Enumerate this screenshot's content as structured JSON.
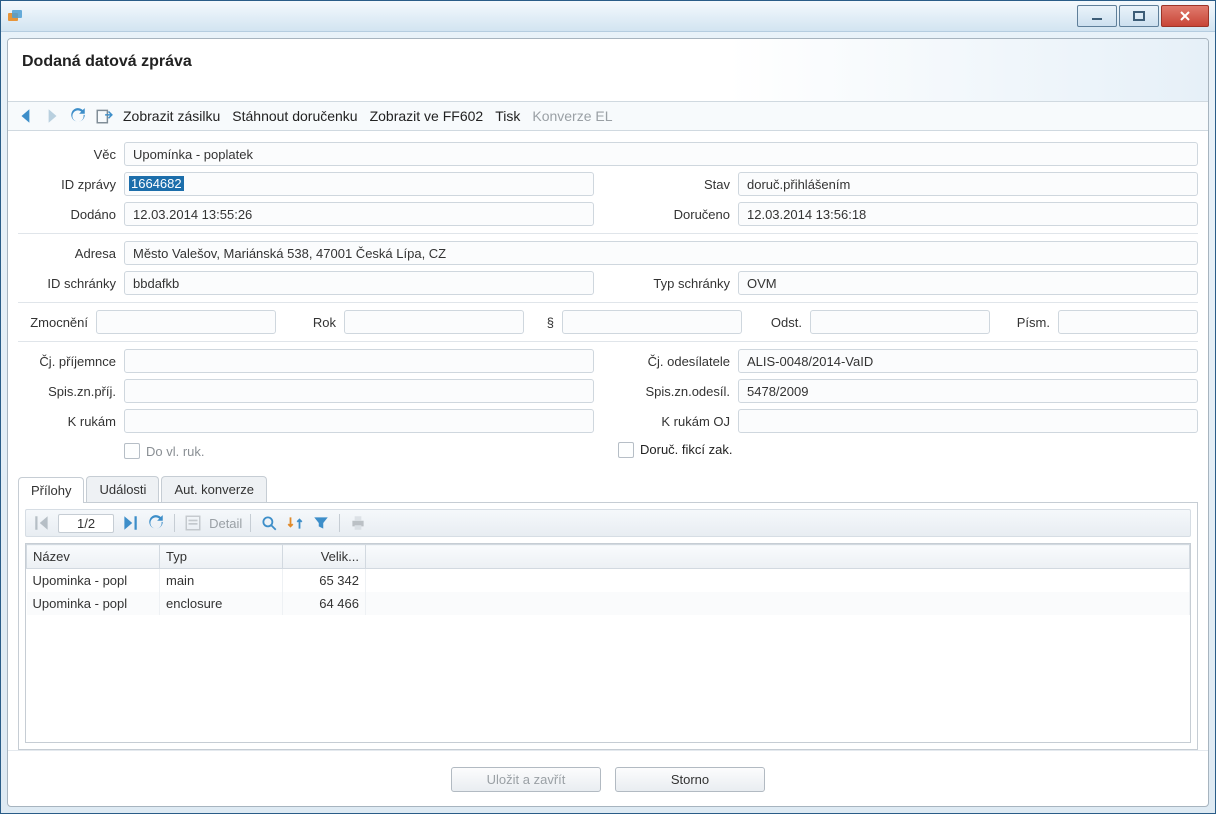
{
  "window": {
    "title": ""
  },
  "header": {
    "title": "Dodaná datová zpráva"
  },
  "toolbar": {
    "show_shipment": "Zobrazit zásilku",
    "download_receipt": "Stáhnout doručenku",
    "show_ff602": "Zobrazit ve FF602",
    "print": "Tisk",
    "konverze_el": "Konverze EL"
  },
  "labels": {
    "vec": "Věc",
    "id_zpravy": "ID zprávy",
    "dodano": "Dodáno",
    "stav": "Stav",
    "doruceno": "Doručeno",
    "adresa": "Adresa",
    "id_schranky": "ID schránky",
    "typ_schranky": "Typ schránky",
    "zmocneni": "Zmocnění",
    "rok": "Rok",
    "paragraf": "§",
    "odst": "Odst.",
    "pism": "Písm.",
    "cj_prijemce": "Čj. příjemnce",
    "cj_odesilatele": "Čj. odesílatele",
    "spis_zn_prij": "Spis.zn.příj.",
    "spis_zn_odesil": "Spis.zn.odesíl.",
    "k_rukam": "K rukám",
    "k_rukam_oj": "K rukám OJ",
    "do_vl_ruk": "Do vl. ruk.",
    "doruc_fikci_zak": "Doruč. fikcí zak."
  },
  "values": {
    "vec": "Upomínka - poplatek",
    "id_zpravy": "1664682",
    "dodano": "12.03.2014 13:55:26",
    "stav": "doruč.přihlášením",
    "doruceno": "12.03.2014 13:56:18",
    "adresa": "Město Valešov, Mariánská 538, 47001 Česká Lípa, CZ",
    "id_schranky": "bbdafkb",
    "typ_schranky": "OVM",
    "zmocneni": "",
    "rok": "",
    "paragraf": "",
    "odst": "",
    "pism": "",
    "cj_prijemce": "",
    "cj_odesilatele": "ALIS-0048/2014-VaID",
    "spis_zn_prij": "",
    "spis_zn_odesil": "5478/2009",
    "k_rukam": "",
    "k_rukam_oj": ""
  },
  "tabs": {
    "prilohy": "Přílohy",
    "udalosti": "Události",
    "aut_konverze": "Aut. konverze"
  },
  "attachments": {
    "counter": "1/2",
    "detail": "Detail",
    "columns": {
      "name": "Název",
      "type": "Typ",
      "size": "Velik..."
    },
    "rows": [
      {
        "name": "Upominka - popl",
        "type": "main",
        "size": "65 342"
      },
      {
        "name": "Upominka - popl",
        "type": "enclosure",
        "size": "64 466"
      }
    ]
  },
  "footer": {
    "save_close": "Uložit a zavřít",
    "cancel": "Storno"
  }
}
